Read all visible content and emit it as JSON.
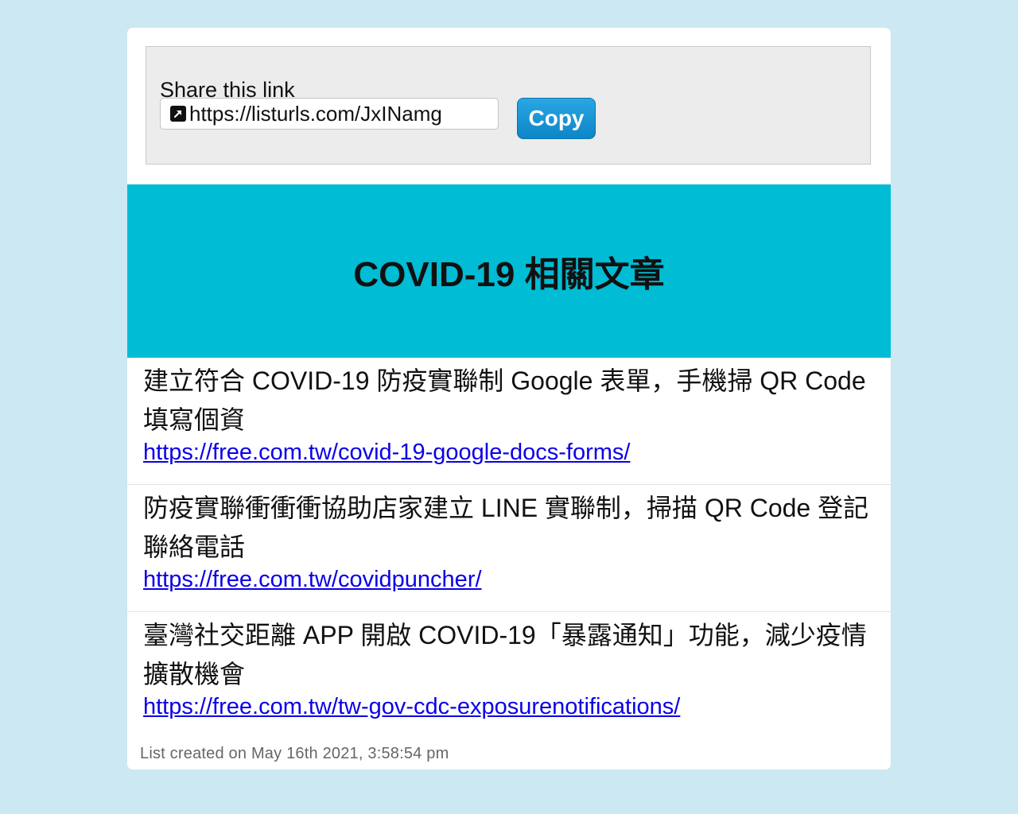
{
  "share": {
    "label": "Share this link",
    "url": "https://listurls.com/JxINamg",
    "copy_label": "Copy"
  },
  "banner": {
    "title": "COVID-19 相關文章"
  },
  "items": [
    {
      "title": "建立符合 COVID-19 防疫實聯制 Google 表單，手機掃 QR Code 填寫個資",
      "url": "https://free.com.tw/covid-19-google-docs-forms/"
    },
    {
      "title": "防疫實聯衝衝衝協助店家建立 LINE 實聯制，掃描 QR Code 登記聯絡電話",
      "url": "https://free.com.tw/covidpuncher/"
    },
    {
      "title": "臺灣社交距離 APP 開啟 COVID-19「暴露通知」功能，減少疫情擴散機會",
      "url": "https://free.com.tw/tw-gov-cdc-exposurenotifications/"
    }
  ],
  "footer": {
    "text": "List created on May 16th 2021, 3:58:54 pm"
  },
  "colors": {
    "page_bg": "#cce8f2",
    "banner_bg": "#00bcd4",
    "link": "#0a00e6",
    "copy_button": "#1a96d6"
  }
}
